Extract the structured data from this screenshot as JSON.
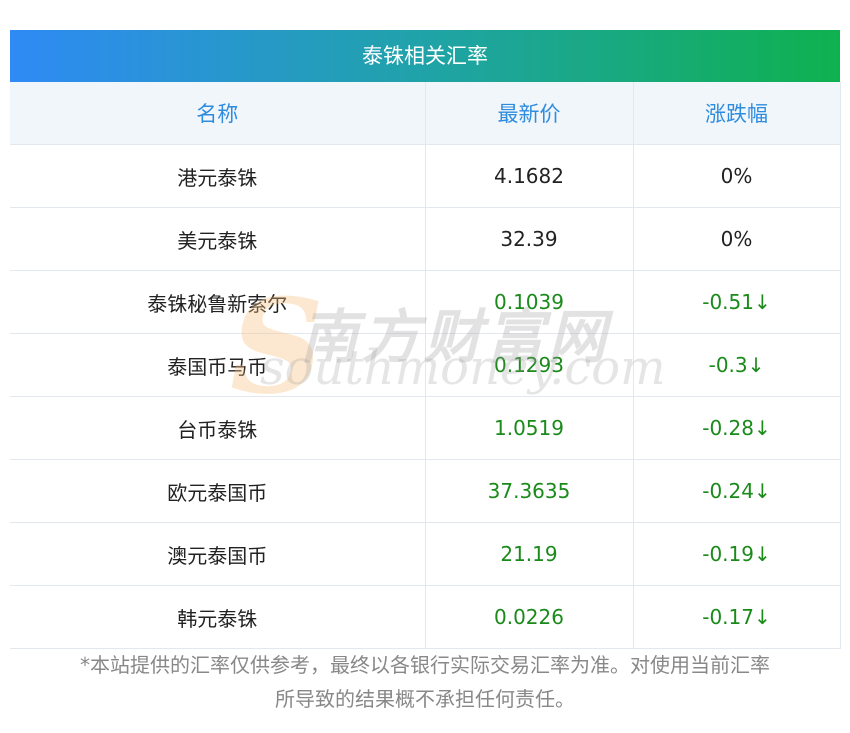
{
  "title": "泰铢相关汇率",
  "headers": {
    "name": "名称",
    "price": "最新价",
    "change": "涨跌幅"
  },
  "rows": [
    {
      "name": "港元泰铢",
      "price": "4.1682",
      "change": "0%",
      "dir": "flat"
    },
    {
      "name": "美元泰铢",
      "price": "32.39",
      "change": "0%",
      "dir": "flat"
    },
    {
      "name": "泰铢秘鲁新索尔",
      "price": "0.1039",
      "change": "-0.51↓",
      "dir": "down"
    },
    {
      "name": "泰国币马币",
      "price": "0.1293",
      "change": "-0.3↓",
      "dir": "down"
    },
    {
      "name": "台币泰铢",
      "price": "1.0519",
      "change": "-0.28↓",
      "dir": "down"
    },
    {
      "name": "欧元泰国币",
      "price": "37.3635",
      "change": "-0.24↓",
      "dir": "down"
    },
    {
      "name": "澳元泰国币",
      "price": "21.19",
      "change": "-0.19↓",
      "dir": "down"
    },
    {
      "name": "韩元泰铢",
      "price": "0.0226",
      "change": "-0.17↓",
      "dir": "down"
    }
  ],
  "watermark": {
    "cn": "南方财富网",
    "en": "southmoney.com"
  },
  "footnote": {
    "line1": "*本站提供的汇率仅供参考，最终以各银行实际交易汇率为准。对使用当前汇率",
    "line2": "所导致的结果概不承担任何责任。"
  },
  "colors": {
    "down": "#1a8a1a",
    "header_text": "#2e8cdf",
    "gradient_start": "#2f8af5",
    "gradient_end": "#0fb14f"
  }
}
